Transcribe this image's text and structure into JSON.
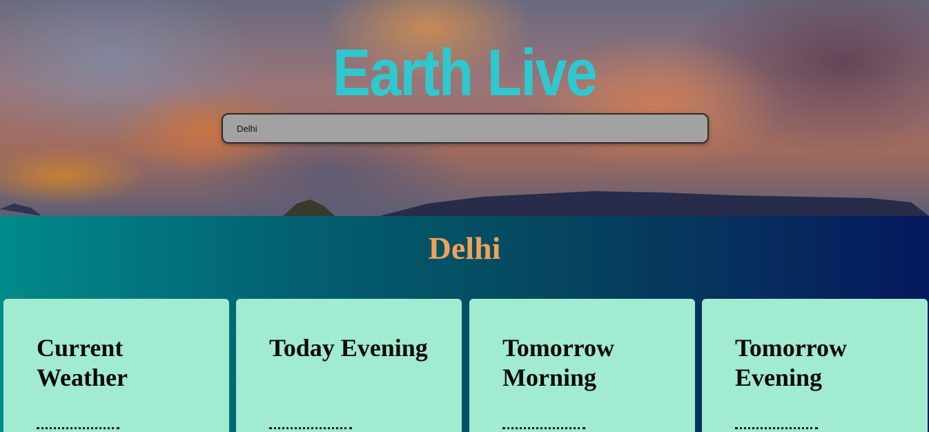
{
  "header": {
    "title": "Earth Live",
    "title_color": "#2fc8cf"
  },
  "search": {
    "value": "Delhi"
  },
  "location": {
    "city": "Delhi",
    "city_color": "#f0a25a"
  },
  "forecast_cards": [
    {
      "title": "Current Weather"
    },
    {
      "title": "Today Evening"
    },
    {
      "title": "Tomorrow Morning"
    },
    {
      "title": "Tomorrow Evening"
    }
  ],
  "colors": {
    "card_bg": "#a1ebd0",
    "section_gradient_start": "#018a8a",
    "section_gradient_end": "#06185e"
  }
}
